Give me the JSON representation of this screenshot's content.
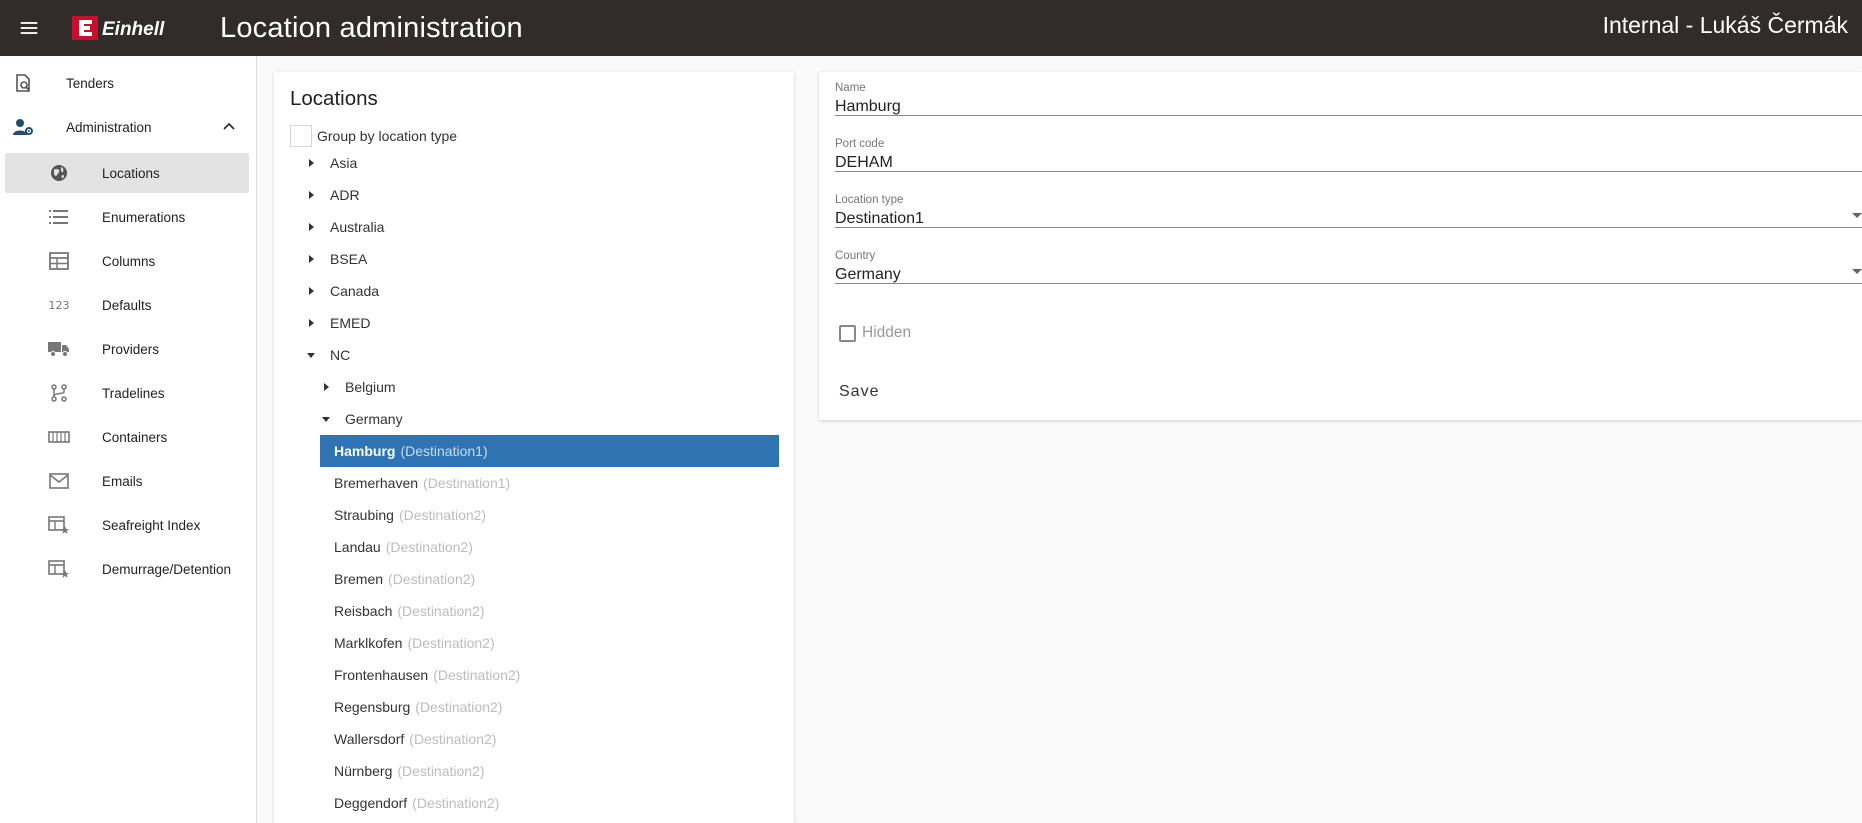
{
  "header": {
    "logo_text": "Einhell",
    "title": "Location administration",
    "user": "Internal - Lukáš Čermák"
  },
  "sidebar": {
    "items": [
      {
        "label": "Tenders",
        "icon": "tenders-icon"
      },
      {
        "label": "Administration",
        "icon": "admin-icon",
        "expanded": true
      },
      {
        "label": "Locations",
        "icon": "globe-icon",
        "active": true
      },
      {
        "label": "Enumerations",
        "icon": "list-icon"
      },
      {
        "label": "Columns",
        "icon": "table-icon"
      },
      {
        "label": "Defaults",
        "icon": "numbers-icon",
        "icon_text": "123"
      },
      {
        "label": "Providers",
        "icon": "truck-icon"
      },
      {
        "label": "Tradelines",
        "icon": "route-icon"
      },
      {
        "label": "Containers",
        "icon": "container-icon"
      },
      {
        "label": "Emails",
        "icon": "mail-icon"
      },
      {
        "label": "Seafreight Index",
        "icon": "table-star-icon"
      },
      {
        "label": "Demurrage/Detention",
        "icon": "table-star-icon"
      }
    ]
  },
  "locations": {
    "title": "Locations",
    "group_by_label": "Group by location type",
    "regions": [
      "Asia",
      "ADR",
      "Australia",
      "BSEA",
      "Canada",
      "EMED",
      "NC"
    ],
    "nc_children": [
      "Belgium",
      "Germany"
    ],
    "germany_locations": [
      {
        "name": "Hamburg",
        "type": "(Destination1)"
      },
      {
        "name": "Bremerhaven",
        "type": "(Destination1)"
      },
      {
        "name": "Straubing",
        "type": "(Destination2)"
      },
      {
        "name": "Landau",
        "type": "(Destination2)"
      },
      {
        "name": "Bremen",
        "type": "(Destination2)"
      },
      {
        "name": "Reisbach",
        "type": "(Destination2)"
      },
      {
        "name": "Marklkofen",
        "type": "(Destination2)"
      },
      {
        "name": "Frontenhausen",
        "type": "(Destination2)"
      },
      {
        "name": "Regensburg",
        "type": "(Destination2)"
      },
      {
        "name": "Wallersdorf",
        "type": "(Destination2)"
      },
      {
        "name": "Nürnberg",
        "type": "(Destination2)"
      },
      {
        "name": "Deggendorf",
        "type": "(Destination2)"
      }
    ]
  },
  "detail": {
    "name_label": "Name",
    "name_value": "Hamburg",
    "port_label": "Port code",
    "port_value": "DEHAM",
    "type_label": "Location type",
    "type_value": "Destination1",
    "country_label": "Country",
    "country_value": "Germany",
    "hidden_label": "Hidden",
    "save_label": "Save"
  },
  "colors": {
    "topbar": "#312c29",
    "logo_red": "#c8102e",
    "selected": "#2f73b2"
  }
}
